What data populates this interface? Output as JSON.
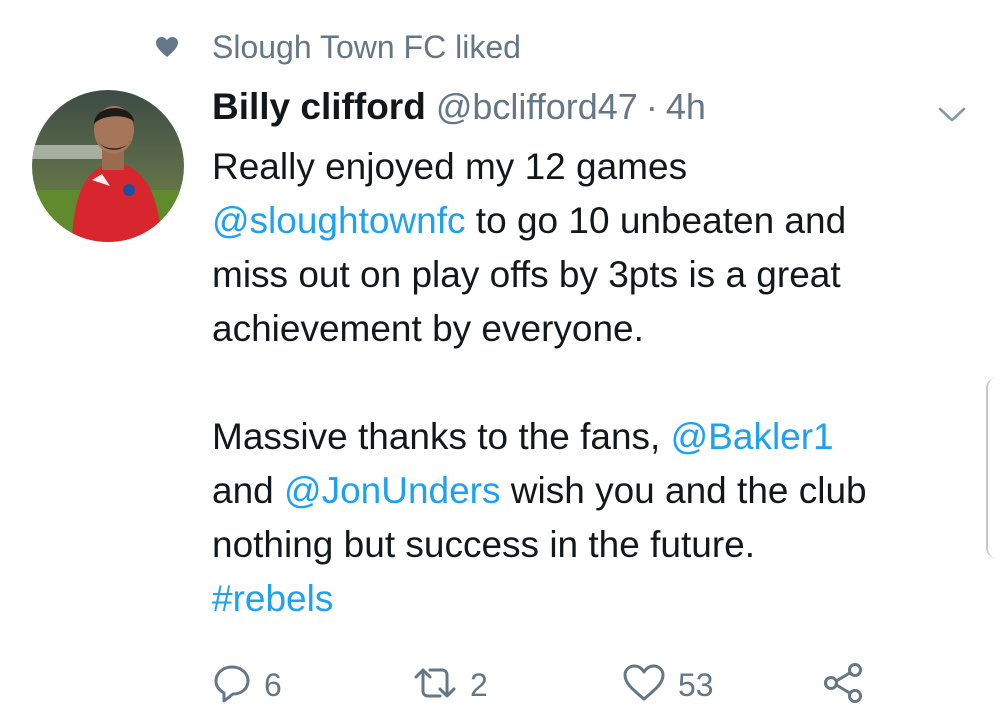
{
  "social_context": {
    "icon": "heart-icon",
    "text": "Slough Town FC liked"
  },
  "tweet": {
    "display_name": "Billy clifford",
    "handle": "@bclifford47",
    "separator": "·",
    "time": "4h",
    "body": {
      "line1": "Really enjoyed my 12 games",
      "line2_mention": "@sloughtownfc",
      "line2_text": " to go 10 unbeaten and",
      "line3": "miss out on play offs by 3pts is a great",
      "line4": "achievement by everyone.",
      "line5_text": "Massive thanks to the fans, ",
      "line5_mention": "@Bakler1",
      "line6_text1": "and ",
      "line6_mention": "@JonUnders",
      "line6_text2": " wish you and the club",
      "line7": "nothing but success in the future.",
      "hashtag": "#rebels"
    },
    "actions": {
      "reply_count": "6",
      "retweet_count": "2",
      "like_count": "53"
    }
  },
  "colors": {
    "link": "#1da1f2",
    "secondary_text": "#657786",
    "primary_text": "#14171a",
    "avatar_kit": "#d7262e"
  }
}
